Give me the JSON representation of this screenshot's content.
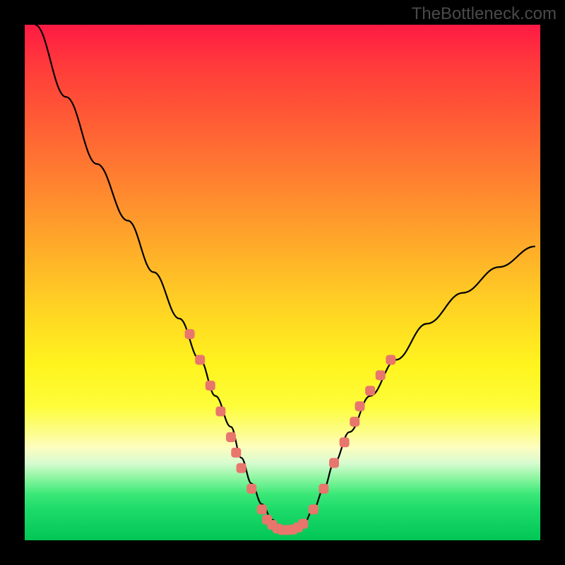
{
  "watermark": "TheBottleneck.com",
  "chart_data": {
    "type": "line",
    "title": "",
    "xlabel": "",
    "ylabel": "",
    "xlim": [
      0,
      100
    ],
    "ylim": [
      0,
      100
    ],
    "grid": false,
    "legend": false,
    "series": [
      {
        "name": "curve",
        "color": "#000000",
        "x": [
          2,
          8,
          14,
          20,
          25,
          30,
          34,
          37,
          40,
          42,
          44,
          46,
          48,
          50,
          52,
          54,
          56,
          58,
          60,
          63,
          67,
          72,
          78,
          85,
          92,
          99
        ],
        "y": [
          100,
          86,
          73,
          62,
          52,
          43,
          35,
          28,
          22,
          16,
          11,
          7,
          4,
          2,
          2,
          3,
          6,
          10,
          15,
          21,
          28,
          35,
          42,
          48,
          53,
          57
        ]
      }
    ],
    "markers": {
      "name": "highlight-points",
      "color": "#e8766c",
      "size": 7,
      "points": [
        {
          "x": 32,
          "y": 40
        },
        {
          "x": 34,
          "y": 35
        },
        {
          "x": 36,
          "y": 30
        },
        {
          "x": 38,
          "y": 25
        },
        {
          "x": 40,
          "y": 20
        },
        {
          "x": 41,
          "y": 17
        },
        {
          "x": 42,
          "y": 14
        },
        {
          "x": 44,
          "y": 10
        },
        {
          "x": 46,
          "y": 6
        },
        {
          "x": 47,
          "y": 4
        },
        {
          "x": 48,
          "y": 3
        },
        {
          "x": 49,
          "y": 2.3
        },
        {
          "x": 50,
          "y": 2
        },
        {
          "x": 51,
          "y": 2
        },
        {
          "x": 52,
          "y": 2.1
        },
        {
          "x": 53,
          "y": 2.5
        },
        {
          "x": 54,
          "y": 3.2
        },
        {
          "x": 56,
          "y": 6
        },
        {
          "x": 58,
          "y": 10
        },
        {
          "x": 60,
          "y": 15
        },
        {
          "x": 62,
          "y": 19
        },
        {
          "x": 64,
          "y": 23
        },
        {
          "x": 65,
          "y": 26
        },
        {
          "x": 67,
          "y": 29
        },
        {
          "x": 69,
          "y": 32
        },
        {
          "x": 71,
          "y": 35
        }
      ]
    },
    "gradient_stops": [
      {
        "pos": 0,
        "color": "#ff1a44"
      },
      {
        "pos": 50,
        "color": "#ffc824"
      },
      {
        "pos": 75,
        "color": "#fdfd3a"
      },
      {
        "pos": 100,
        "color": "#00c655"
      }
    ]
  }
}
